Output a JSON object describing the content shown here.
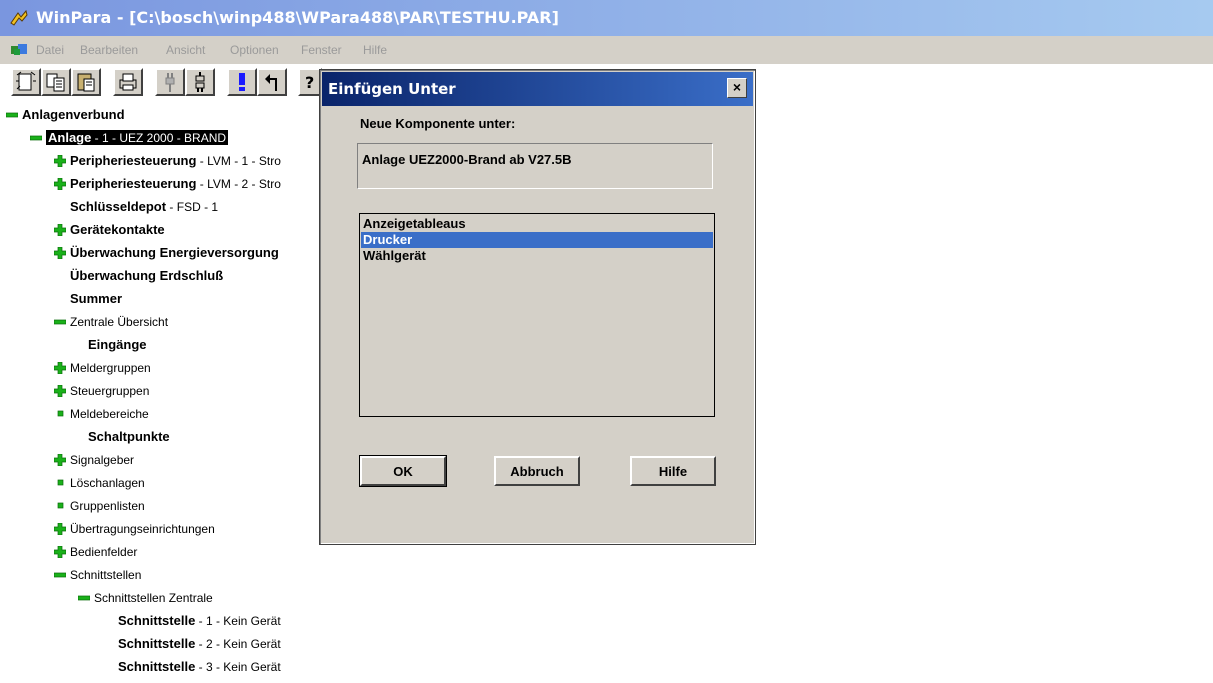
{
  "window": {
    "title": "WinPara - [C:\\bosch\\winp488\\WPara488\\PAR\\TESTHU.PAR]"
  },
  "menu": {
    "items": [
      "Datei",
      "Bearbeiten",
      "Ansicht",
      "Optionen",
      "Fenster",
      "Hilfe"
    ]
  },
  "toolbar": {
    "buttons": [
      "new-icon",
      "copy-icon",
      "paste-icon",
      "print-icon",
      "plug-icon",
      "unplug-icon",
      "exclamation-icon",
      "undo-icon",
      "help-icon"
    ]
  },
  "tree": {
    "root": "Anlagenverbund",
    "anlage": {
      "name": "Anlage",
      "desc": " - 1 - UEZ 2000 - BRAND"
    },
    "items": [
      {
        "name": "Peripheriesteuerung",
        "desc": " - LVM - 1 - Stro"
      },
      {
        "name": "Peripheriesteuerung",
        "desc": " - LVM - 2 - Stro"
      },
      {
        "name": "Schlüsseldepot",
        "desc": " - FSD - 1"
      },
      {
        "name": "Gerätekontakte",
        "desc": ""
      },
      {
        "name": "Überwachung Energieversorgung",
        "desc": ""
      },
      {
        "name": "Überwachung Erdschluß",
        "desc": ""
      },
      {
        "name": "Summer",
        "desc": ""
      },
      {
        "name": "Zentrale Übersicht",
        "desc": ""
      },
      {
        "name": "Eingänge",
        "desc": ""
      },
      {
        "name": "Meldergruppen",
        "desc": ""
      },
      {
        "name": "Steuergruppen",
        "desc": ""
      },
      {
        "name": "Meldebereiche",
        "desc": ""
      },
      {
        "name": "Schaltpunkte",
        "desc": ""
      },
      {
        "name": "Signalgeber",
        "desc": ""
      },
      {
        "name": "Löschanlagen",
        "desc": ""
      },
      {
        "name": "Gruppenlisten",
        "desc": ""
      },
      {
        "name": "Übertragungseinrichtungen",
        "desc": ""
      },
      {
        "name": "Bedienfelder",
        "desc": ""
      },
      {
        "name": "Schnittstellen",
        "desc": ""
      },
      {
        "name": "Schnittstellen Zentrale",
        "desc": ""
      },
      {
        "name": "Schnittstelle",
        "desc": " - 1 - Kein Gerät"
      },
      {
        "name": "Schnittstelle",
        "desc": " - 2 - Kein Gerät"
      },
      {
        "name": "Schnittstelle",
        "desc": " - 3 - Kein Gerät"
      }
    ]
  },
  "dialog": {
    "title": "Einfügen Unter",
    "close": "×",
    "label": "Neue Komponente unter:",
    "parent_value": "Anlage UEZ2000-Brand ab V27.5B",
    "list": [
      "Anzeigetableaus",
      "Drucker",
      "Wählgerät"
    ],
    "selected_index": 1,
    "ok": "OK",
    "cancel": "Abbruch",
    "help": "Hilfe"
  },
  "colors": {
    "title_bar": "#7a96df",
    "dialog_title": "#0a246a",
    "selection": "#3a6ec8",
    "tree_icon": "#1ab11a"
  }
}
